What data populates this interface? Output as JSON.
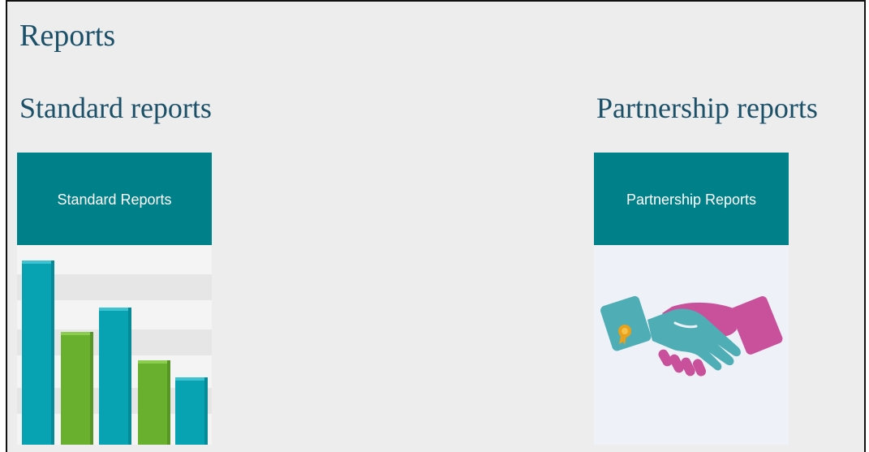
{
  "page": {
    "title": "Reports"
  },
  "sections": {
    "standard": {
      "heading": "Standard reports",
      "tile_label": "Standard Reports",
      "image_icon": "bar-chart-icon"
    },
    "partnership": {
      "heading": "Partnership reports",
      "tile_label": "Partnership Reports",
      "image_icon": "handshake-icon"
    }
  },
  "colors": {
    "heading_text": "#1b5069",
    "tile_header": "#008089",
    "bar_teal": "#07a3b3",
    "bar_green": "#69b02e",
    "handshake_teal": "#4faeb5",
    "handshake_pink": "#c9509a",
    "badge_gold": "#e9a11b"
  }
}
